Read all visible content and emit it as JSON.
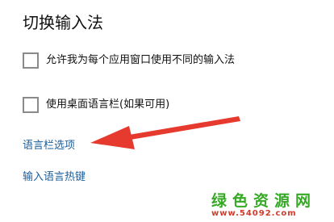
{
  "page": {
    "title": "切换输入法"
  },
  "options": [
    {
      "label": "允许我为每个应用窗口使用不同的输入法",
      "checked": false
    },
    {
      "label": "使用桌面语言栏(如果可用)",
      "checked": false
    }
  ],
  "links": {
    "language_bar_options": "语言栏选项",
    "input_language_hotkeys": "输入语言热键"
  },
  "watermark": {
    "text": "绿色资源网",
    "url": "www.54092.com"
  },
  "colors": {
    "link": "#1b5e9b",
    "arrow": "#e63a2f",
    "watermark_main": "#35a925",
    "watermark_url": "#d23b2c"
  },
  "icons": {
    "arrow": "red-annotation-arrow-icon"
  }
}
